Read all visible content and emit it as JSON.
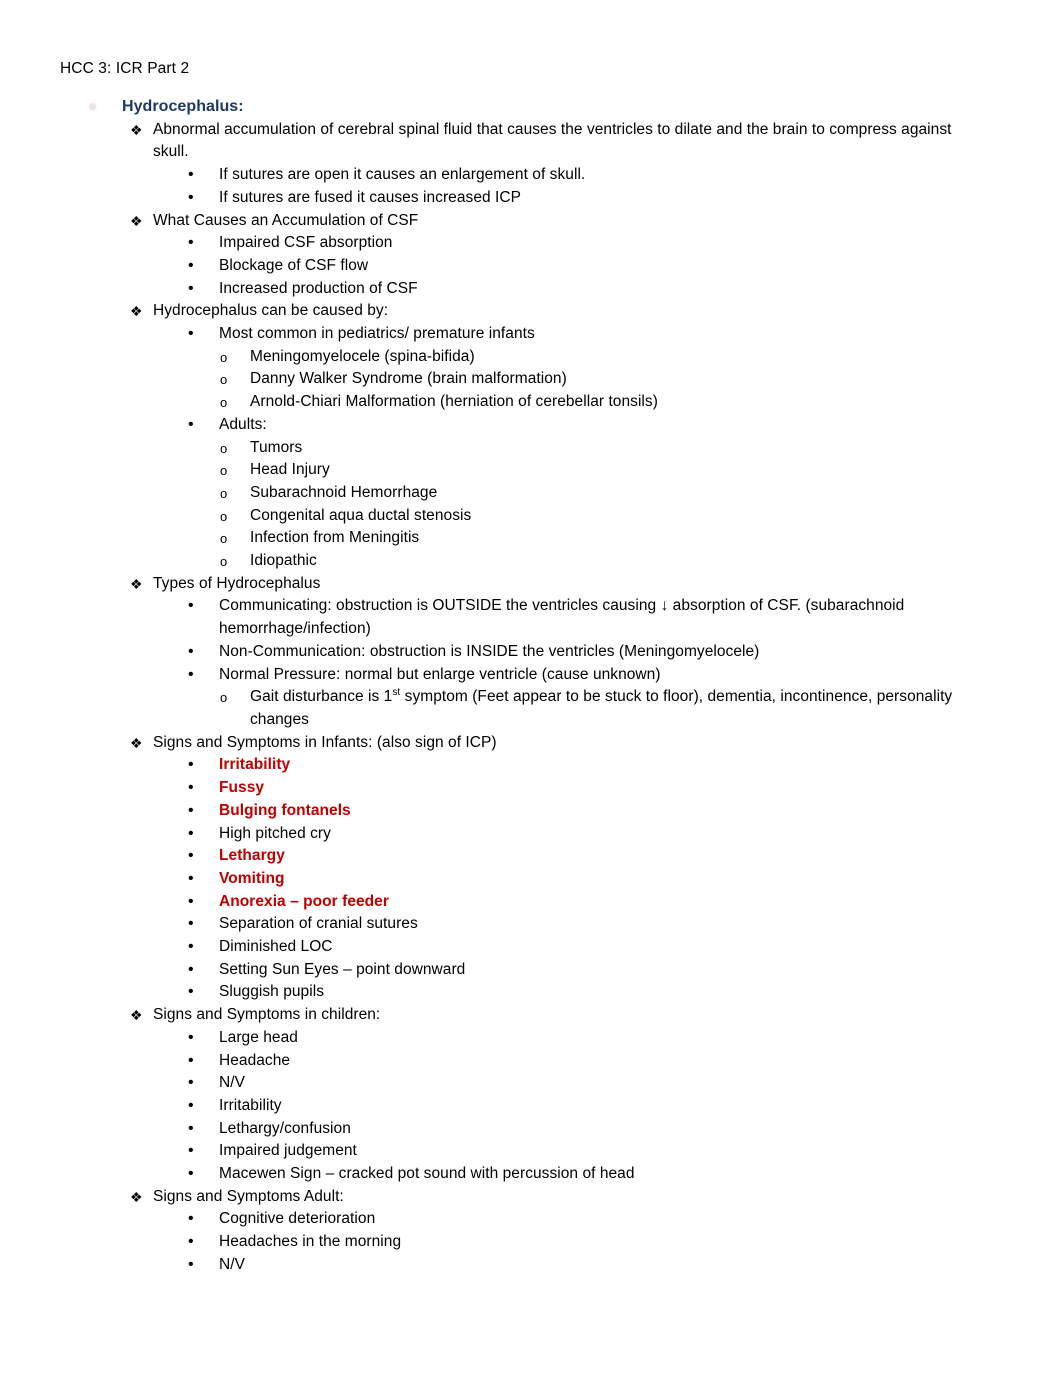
{
  "document": {
    "header": "HCC 3: ICR Part 2",
    "title": "Hydrocephalus:",
    "title_color": "#1F3864",
    "highlight_color": "#C00000",
    "bullets": {
      "level1_marker": "❖",
      "level2_marker": "•",
      "level3_marker": "o",
      "title_marker": "●"
    }
  },
  "outline": [
    {
      "level": 1,
      "text": "Abnormal accumulation of cerebral spinal fluid that causes the ventricles to dilate and the brain to compress against skull."
    },
    {
      "level": 2,
      "text": "If sutures are open it causes an enlargement of skull."
    },
    {
      "level": 2,
      "text": "If sutures are fused it causes increased ICP"
    },
    {
      "level": 1,
      "text": "What Causes an Accumulation of CSF"
    },
    {
      "level": 2,
      "text": "Impaired CSF absorption"
    },
    {
      "level": 2,
      "text": "Blockage of CSF flow"
    },
    {
      "level": 2,
      "text": "Increased production of CSF"
    },
    {
      "level": 1,
      "text": "Hydrocephalus can be caused by:"
    },
    {
      "level": 2,
      "text": "Most common in pediatrics/ premature infants"
    },
    {
      "level": 3,
      "text": "Meningomyelocele (spina-bifida)"
    },
    {
      "level": 3,
      "text": "Danny Walker Syndrome (brain malformation)"
    },
    {
      "level": 3,
      "text": "Arnold-Chiari Malformation (herniation of cerebellar tonsils)"
    },
    {
      "level": 2,
      "text": "Adults:"
    },
    {
      "level": 3,
      "text": "Tumors"
    },
    {
      "level": 3,
      "text": "Head Injury"
    },
    {
      "level": 3,
      "text": "Subarachnoid Hemorrhage"
    },
    {
      "level": 3,
      "text": "Congenital aqua ductal stenosis"
    },
    {
      "level": 3,
      "text": "Infection from Meningitis"
    },
    {
      "level": 3,
      "text": "Idiopathic"
    },
    {
      "level": 1,
      "text": "Types of Hydrocephalus"
    },
    {
      "level": 2,
      "text": "Communicating: obstruction is OUTSIDE the ventricles causing ↓ absorption of CSF. (subarachnoid hemorrhage/infection)"
    },
    {
      "level": 2,
      "text": "Non-Communication: obstruction is INSIDE the ventricles (Meningomyelocele)"
    },
    {
      "level": 2,
      "text": "Normal Pressure: normal but enlarge ventricle (cause unknown)"
    },
    {
      "level": 3,
      "html": true,
      "text": "Gait disturbance is 1<sup>st</sup> symptom (Feet appear to be stuck to floor), dementia, incontinence, personality changes"
    },
    {
      "level": 1,
      "text": "Signs and Symptoms in Infants: (also sign of ICP)"
    },
    {
      "level": 2,
      "text": "Irritability",
      "emphasis": "red"
    },
    {
      "level": 2,
      "text": "Fussy",
      "emphasis": "red"
    },
    {
      "level": 2,
      "text": "Bulging fontanels",
      "emphasis": "red"
    },
    {
      "level": 2,
      "text": "High pitched cry"
    },
    {
      "level": 2,
      "text": "Lethargy",
      "emphasis": "red"
    },
    {
      "level": 2,
      "text": "Vomiting",
      "emphasis": "red"
    },
    {
      "level": 2,
      "text": "Anorexia – poor feeder",
      "emphasis": "red"
    },
    {
      "level": 2,
      "text": "Separation of cranial sutures"
    },
    {
      "level": 2,
      "text": "Diminished LOC"
    },
    {
      "level": 2,
      "text": "Setting Sun Eyes – point downward"
    },
    {
      "level": 2,
      "text": "Sluggish pupils"
    },
    {
      "level": 1,
      "text": "Signs and Symptoms in children:"
    },
    {
      "level": 2,
      "text": "Large head"
    },
    {
      "level": 2,
      "text": "Headache"
    },
    {
      "level": 2,
      "text": "N/V"
    },
    {
      "level": 2,
      "text": "Irritability"
    },
    {
      "level": 2,
      "text": "Lethargy/confusion"
    },
    {
      "level": 2,
      "text": "Impaired judgement"
    },
    {
      "level": 2,
      "text": "Macewen Sign – cracked pot sound with percussion of head"
    },
    {
      "level": 1,
      "text": "Signs and Symptoms Adult:"
    },
    {
      "level": 2,
      "text": "Cognitive deterioration"
    },
    {
      "level": 2,
      "text": "Headaches in the morning"
    },
    {
      "level": 2,
      "text": "N/V"
    }
  ]
}
